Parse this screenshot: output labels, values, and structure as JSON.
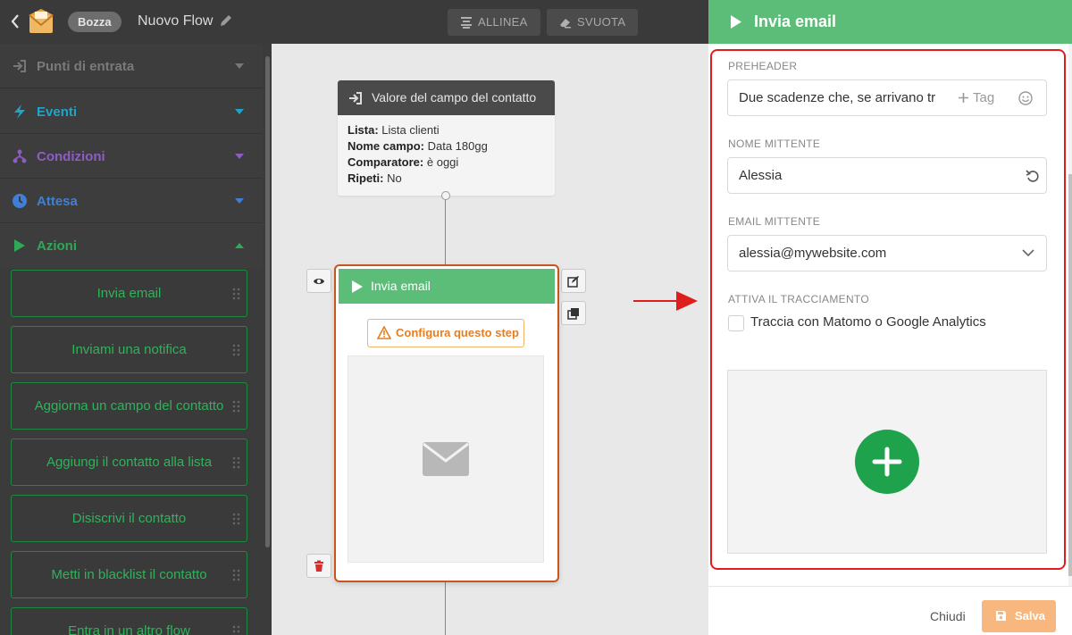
{
  "topbar": {
    "draft_badge": "Bozza",
    "flow_title": "Nuovo Flow",
    "align_label": "ALLINEA",
    "clear_label": "SVUOTA"
  },
  "sidebar": {
    "sections": [
      {
        "label": "Punti di entrata",
        "color": "#7a7a7a",
        "icon": "sign-in-icon",
        "expanded": false
      },
      {
        "label": "Eventi",
        "color": "#1fa5c9",
        "icon": "bolt-icon",
        "expanded": false
      },
      {
        "label": "Condizioni",
        "color": "#8e5cc4",
        "icon": "sitemap-icon",
        "expanded": false
      },
      {
        "label": "Attesa",
        "color": "#3f7fd6",
        "icon": "clock-icon",
        "expanded": false
      },
      {
        "label": "Azioni",
        "color": "#2fa857",
        "icon": "play-icon",
        "expanded": true
      }
    ],
    "actions": [
      "Invia email",
      "Inviami una notifica",
      "Aggiorna un campo del contatto",
      "Aggiungi il contatto alla lista",
      "Disiscrivi il contatto",
      "Metti in blacklist il contatto",
      "Entra in un altro flow"
    ]
  },
  "canvas": {
    "trigger_node": {
      "title": "Valore del campo del contatto",
      "rows": [
        {
          "key": "Lista:",
          "value": "Lista clienti"
        },
        {
          "key": "Nome campo:",
          "value": "Data 180gg"
        },
        {
          "key": "Comparatore:",
          "value": "è oggi"
        },
        {
          "key": "Ripeti:",
          "value": "No"
        }
      ]
    },
    "action_node": {
      "title": "Invia email",
      "configure_label": "Configura questo step"
    }
  },
  "panel": {
    "title": "Invia email",
    "preheader_label": "PREHEADER",
    "preheader_value": "Due scadenze che, se arrivano tr",
    "tag_label": "Tag",
    "sender_name_label": "NOME MITTENTE",
    "sender_name_value": "Alessia",
    "sender_email_label": "EMAIL MITTENTE",
    "sender_email_value": "alessia@mywebsite.com",
    "tracking_label": "ATTIVA IL TRACCIAMENTO",
    "tracking_checkbox_label": "Traccia con Matomo o Google Analytics",
    "tracking_checked": false,
    "close_label": "Chiudi",
    "save_label": "Salva"
  },
  "colors": {
    "accent_green": "#5bbd77",
    "action_green": "#2fb35a",
    "save_orange": "#f8b77e",
    "highlight_red": "#e01d1d"
  }
}
